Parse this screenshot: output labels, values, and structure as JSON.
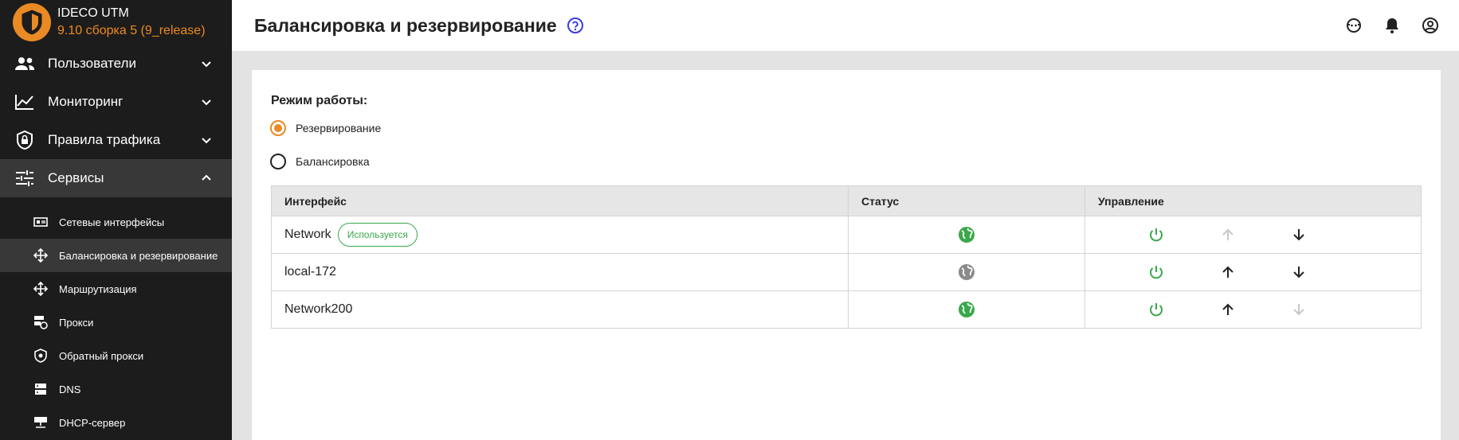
{
  "brand": {
    "name": "IDECO UTM",
    "version": "9.10 сборка 5 (9_release)"
  },
  "nav": [
    {
      "label": "Пользователи",
      "icon": "users-icon",
      "expanded": false
    },
    {
      "label": "Мониторинг",
      "icon": "chart-line-icon",
      "expanded": false
    },
    {
      "label": "Правила трафика",
      "icon": "shield-lock-icon",
      "expanded": false
    },
    {
      "label": "Сервисы",
      "icon": "sliders-icon",
      "expanded": true
    }
  ],
  "subnav": [
    {
      "label": "Сетевые интерфейсы",
      "icon": "network-card-icon"
    },
    {
      "label": "Балансировка и резервирование",
      "icon": "arrows-move-icon",
      "active": true
    },
    {
      "label": "Маршрутизация",
      "icon": "route-icon"
    },
    {
      "label": "Прокси",
      "icon": "proxy-icon"
    },
    {
      "label": "Обратный прокси",
      "icon": "reverse-proxy-icon"
    },
    {
      "label": "DNS",
      "icon": "dns-icon"
    },
    {
      "label": "DHCP-сервер",
      "icon": "dhcp-icon"
    }
  ],
  "header": {
    "title": "Балансировка и резервирование"
  },
  "mode": {
    "label": "Режим работы:",
    "options": [
      {
        "label": "Резервирование",
        "checked": true
      },
      {
        "label": "Балансировка",
        "checked": false
      }
    ]
  },
  "table": {
    "columns": [
      "Интерфейс",
      "Статус",
      "Управление"
    ],
    "rows": [
      {
        "interface": "Network",
        "badge": "Используется",
        "status": "online",
        "up_enabled": false,
        "down_enabled": true
      },
      {
        "interface": "local-172",
        "badge": "",
        "status": "offline",
        "up_enabled": true,
        "down_enabled": true
      },
      {
        "interface": "Network200",
        "badge": "",
        "status": "online",
        "up_enabled": true,
        "down_enabled": false
      }
    ]
  },
  "colors": {
    "accent": "#e98a24",
    "online": "#3aa84a",
    "offline": "#8a8a8a",
    "sidebar": "#1c1c1c",
    "help": "#3b3bdb"
  }
}
